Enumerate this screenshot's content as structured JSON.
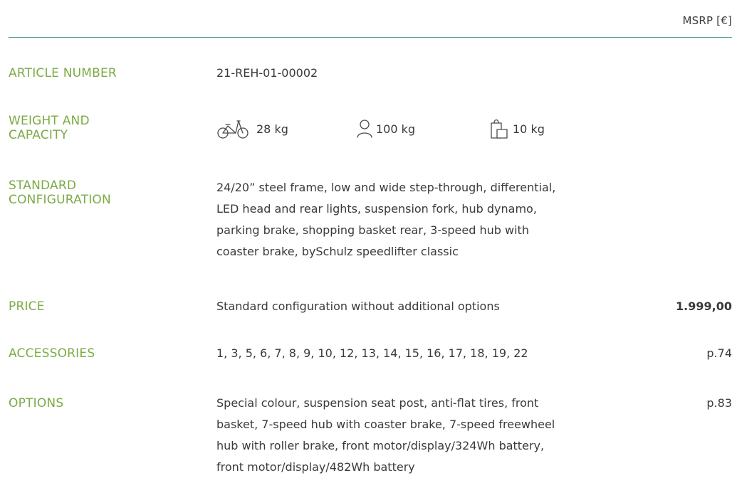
{
  "header": {
    "msrp_label": "MSRP [€]"
  },
  "rows": {
    "article": {
      "label": "ARTICLE NUMBER",
      "value": "21-REH-01-00002"
    },
    "weight": {
      "label_line1": "WEIGHT AND",
      "label_line2": "CAPACITY",
      "bike_weight": "28 kg",
      "rider_capacity": "100 kg",
      "luggage_capacity": "10 kg",
      "icons": [
        "bicycle-icon",
        "person-icon",
        "bag-icon"
      ]
    },
    "standard": {
      "label_line1": "STANDARD",
      "label_line2": "CONFIGURATION",
      "lines": [
        "24/20” steel frame, low and wide step-through, differential,",
        "LED head and rear lights, suspension fork, hub dynamo,",
        "parking brake, shopping basket rear, 3-speed hub with",
        "coaster brake, bySchulz speedlifter classic"
      ]
    },
    "price": {
      "label": "PRICE",
      "value": "Standard configuration without additional options",
      "amount": "1.999,00"
    },
    "accessories": {
      "label": "ACCESSORIES",
      "value": "1, 3, 5, 6, 7, 8, 9, 10, 12, 13, 14, 15, 16, 17, 18, 19, 22",
      "page_ref": "p.74"
    },
    "options": {
      "label": "OPTIONS",
      "lines": [
        "Special colour, suspension seat post, anti-flat tires, front",
        "basket, 7-speed hub with coaster brake, 7-speed freewheel",
        "hub with roller brake, front motor/display/324Wh battery,",
        "front motor/display/482Wh battery"
      ],
      "page_ref": "p.83"
    }
  },
  "colors": {
    "label_green": "#7bab45",
    "rule_teal": "#4a9a96",
    "text": "#3a3a3a"
  }
}
